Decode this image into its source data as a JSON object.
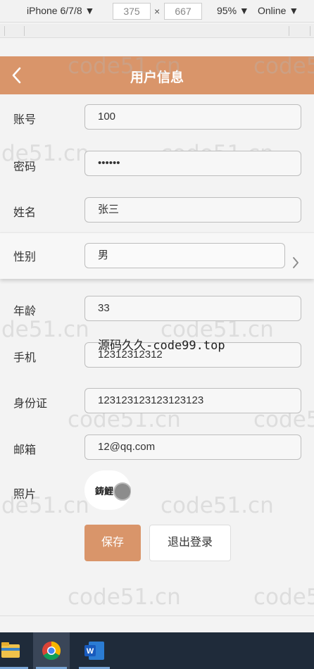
{
  "devtools": {
    "device": "iPhone 6/7/8 ▼",
    "width": "375",
    "times": "×",
    "height": "667",
    "zoom": "95% ▼",
    "network": "Online ▼"
  },
  "header": {
    "title": "用户信息",
    "back_icon": "chevron-left-icon"
  },
  "form": {
    "account": {
      "label": "账号",
      "value": "100"
    },
    "password": {
      "label": "密码",
      "value": "••••••"
    },
    "name": {
      "label": "姓名",
      "value": "张三"
    },
    "gender": {
      "label": "性别",
      "value": "男",
      "icon": "chevron-right-icon"
    },
    "age": {
      "label": "年龄",
      "value": "33"
    },
    "phone": {
      "label": "手机",
      "value": "12312312312"
    },
    "id_card": {
      "label": "身份证",
      "value": "123123123123123123"
    },
    "email": {
      "label": "邮箱",
      "value": "12@qq.com"
    },
    "photo": {
      "label": "照片",
      "signature_text": "鋳鯉"
    }
  },
  "buttons": {
    "save": "保存",
    "logout": "退出登录"
  },
  "overlay_text": "源码久久-code99.top",
  "watermark": "code51.cn",
  "watermark_partial": "de51.cn",
  "taskbar": {
    "items": [
      "folder-icon",
      "chrome-icon",
      "word-icon"
    ]
  },
  "colors": {
    "accent": "#d9956a",
    "background": "#f3f3f3",
    "taskbar": "#1f2b3a"
  }
}
